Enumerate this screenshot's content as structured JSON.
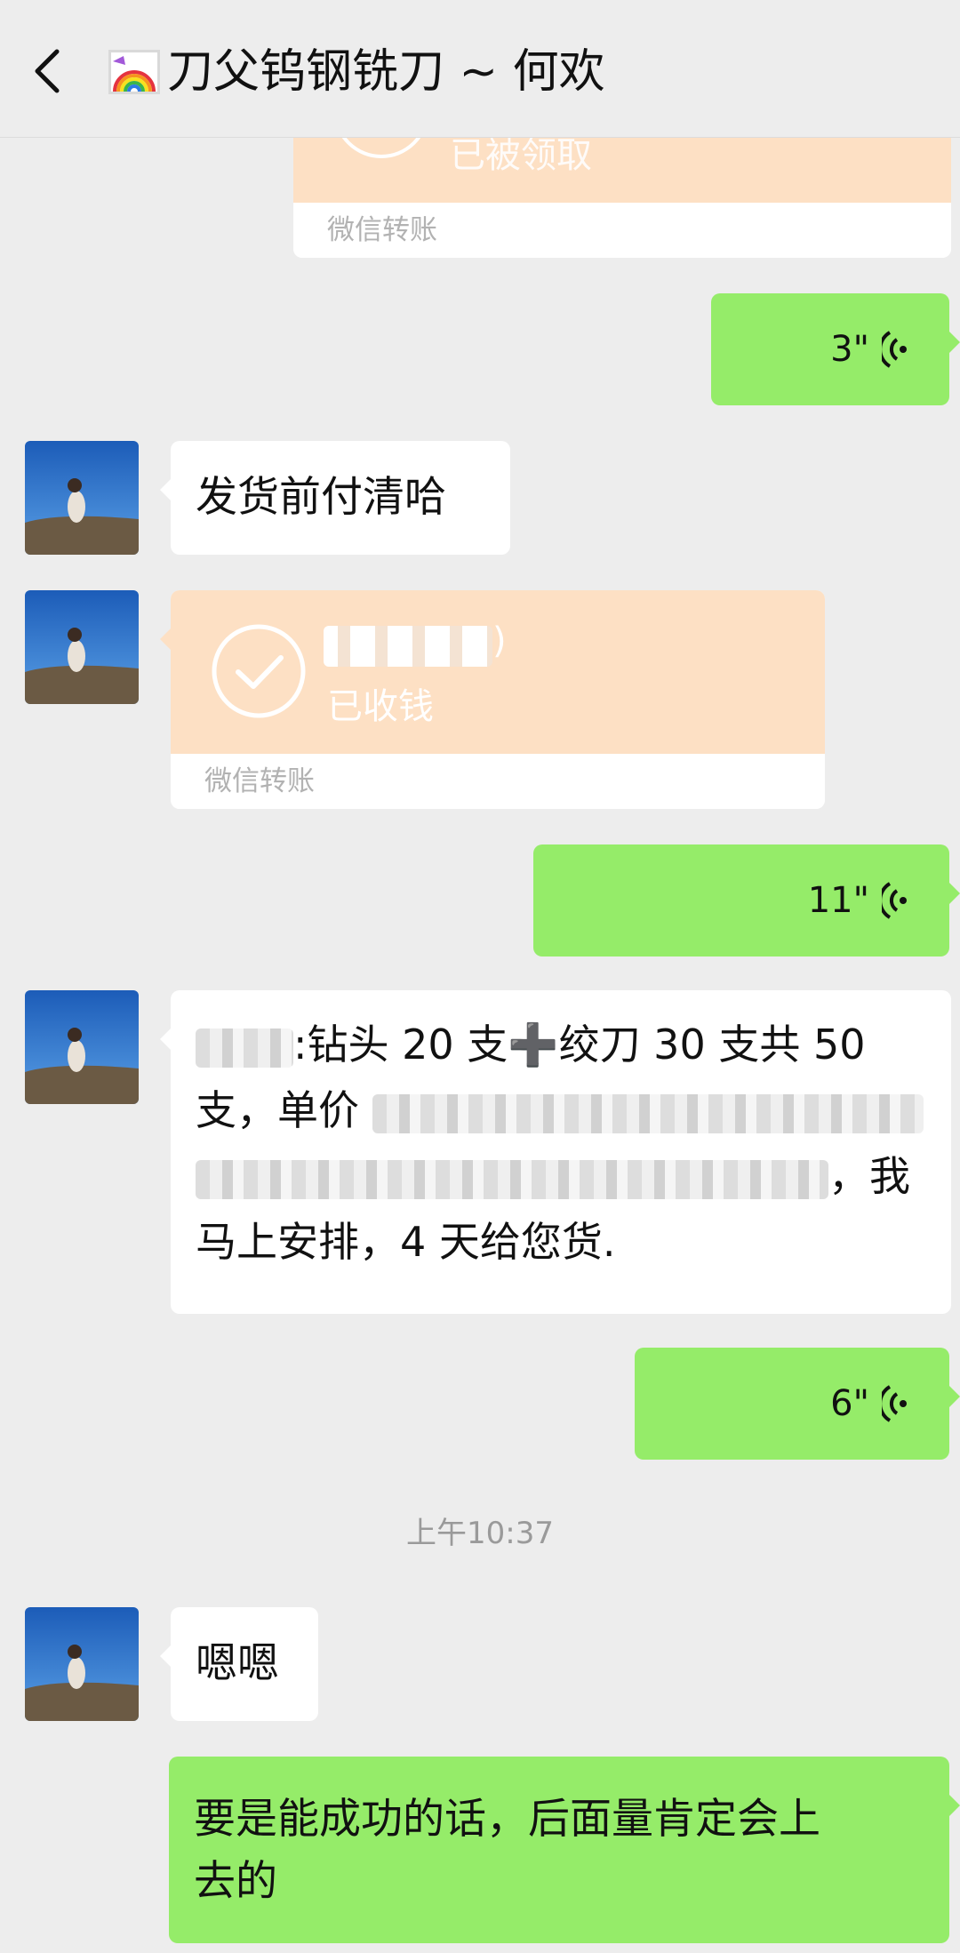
{
  "header": {
    "title": "刀父钨钢铣刀 ~ 何欢",
    "rainbow_icon": "rainbow-emoji-icon",
    "back_icon": "chevron-left-icon"
  },
  "colors": {
    "background": "#ededed",
    "bubble_in": "#ffffff",
    "bubble_out": "#95ec69",
    "transfer_orange": "#fde0c4",
    "timestamp": "#9a9a9a"
  },
  "messages": {
    "transfer1": {
      "status": "已被领取",
      "footer": "微信转账"
    },
    "voice1": {
      "duration": "3\""
    },
    "text1": {
      "text": "发货前付清哈"
    },
    "transfer2": {
      "status": "已收钱",
      "footer": "微信转账",
      "amount_suffix": ")"
    },
    "voice2": {
      "duration": "11\""
    },
    "text2": {
      "line1_rest": ":钻头 20 支",
      "plus": "➕",
      "line1_tail": "绞刀 30 支共 50",
      "line2": "支，单价",
      "line3_tail": "，我",
      "line4": "马上安排，4 天给您货."
    },
    "voice3": {
      "duration": "6\""
    },
    "timestamp": "上午10:37",
    "text3": {
      "text": "嗯嗯"
    },
    "text4": {
      "line1": "要是能成功的话，后面量肯定会上",
      "line2": "去的"
    }
  }
}
